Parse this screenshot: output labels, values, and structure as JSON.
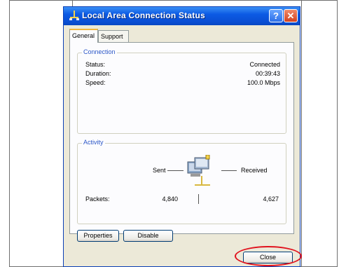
{
  "window": {
    "title": "Local Area Connection Status",
    "help_button": "?",
    "close_button": "✕"
  },
  "tabs": [
    {
      "label": "General",
      "active": true
    },
    {
      "label": "Support",
      "active": false
    }
  ],
  "connection": {
    "legend": "Connection",
    "rows": [
      {
        "label": "Status:",
        "value": "Connected"
      },
      {
        "label": "Duration:",
        "value": "00:39:43"
      },
      {
        "label": "Speed:",
        "value": "100.0 Mbps"
      }
    ]
  },
  "activity": {
    "legend": "Activity",
    "sent_label": "Sent",
    "received_label": "Received",
    "packets_label": "Packets:",
    "packets_sent": "4,840",
    "packets_received": "4,627",
    "icon": "network-computers-icon"
  },
  "buttons": {
    "properties": "Properties",
    "disable": "Disable",
    "close": "Close"
  },
  "colors": {
    "titlebar": "#0a4fd4",
    "legend_text": "#2b56c7",
    "highlight_oval": "#e1121d"
  }
}
